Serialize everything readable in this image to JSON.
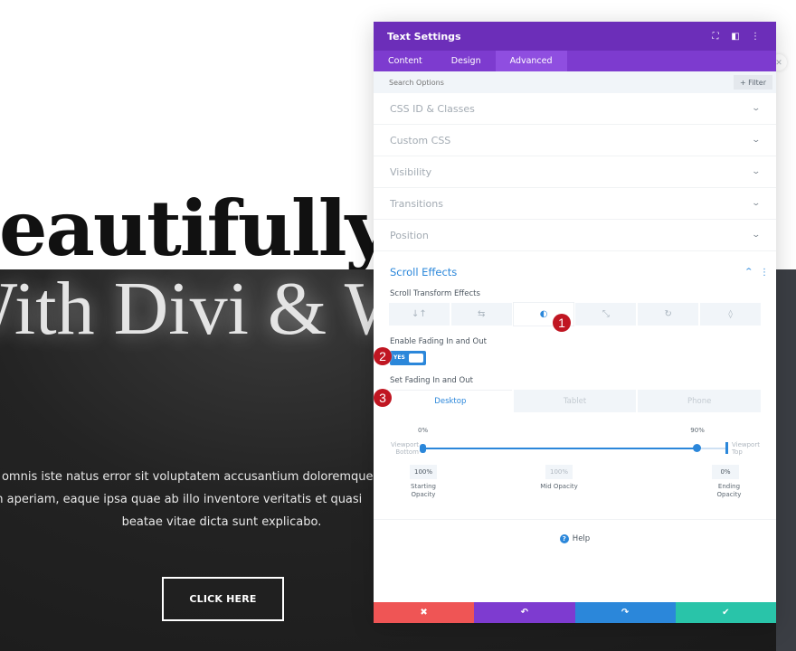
{
  "page": {
    "hero_line1": "Beautifully Crafted",
    "hero_line2": "With Divi & WordPress",
    "body_lines": [
      "Sed ut perspiciatis unde omnis iste natus error sit voluptatem accusantium doloremque",
      "laudantium, totam rem aperiam, eaque ipsa quae ab illo inventore veritatis et quasi",
      "beatae vitae dicta sunt explicabo."
    ],
    "cta_label": "CLICK HERE"
  },
  "modal": {
    "title": "Text Settings",
    "header_icons": [
      "fullscreen-icon",
      "split-view-icon",
      "more-options-icon"
    ],
    "tabs": [
      {
        "label": "Content",
        "active": false
      },
      {
        "label": "Design",
        "active": false
      },
      {
        "label": "Advanced",
        "active": true
      }
    ],
    "search": {
      "placeholder": "Search Options",
      "value": ""
    },
    "filter_label": "+ Filter",
    "sections": [
      {
        "label": "CSS ID & Classes"
      },
      {
        "label": "Custom CSS"
      },
      {
        "label": "Visibility"
      },
      {
        "label": "Transitions"
      },
      {
        "label": "Position"
      }
    ],
    "scroll_effects": {
      "title": "Scroll Effects",
      "transform_label": "Scroll Transform Effects",
      "effects": [
        {
          "icon": "vertical-motion-icon",
          "glyph": "↓↑",
          "active": false
        },
        {
          "icon": "horizontal-motion-icon",
          "glyph": "⇆",
          "active": false
        },
        {
          "icon": "fading-icon",
          "glyph": "◐",
          "active": true
        },
        {
          "icon": "scaling-icon",
          "glyph": "⤡",
          "active": false
        },
        {
          "icon": "rotating-icon",
          "glyph": "↻",
          "active": false
        },
        {
          "icon": "blur-icon",
          "glyph": "💧",
          "active": false
        }
      ],
      "enable_label": "Enable Fading In and Out",
      "toggle_value": "YES",
      "set_label": "Set Fading In and Out",
      "devices": [
        {
          "label": "Desktop",
          "active": true
        },
        {
          "label": "Tablet",
          "active": false
        },
        {
          "label": "Phone",
          "active": false
        }
      ],
      "slider": {
        "start_label": "0%",
        "end_label": "90%",
        "start_value": 0,
        "end_value": 90,
        "viewport_bottom": "Viewport Bottom",
        "viewport_top": "Viewport Top"
      },
      "opacity": {
        "starting": {
          "value": "100%",
          "caption": "Starting Opacity"
        },
        "mid": {
          "value": "100%",
          "caption": "Mid Opacity"
        },
        "ending": {
          "value": "0%",
          "caption": "Ending Opacity"
        }
      }
    },
    "help_label": "Help",
    "footer": [
      {
        "name": "discard",
        "glyph": "✖",
        "color": "#ef5555"
      },
      {
        "name": "undo",
        "glyph": "↶",
        "color": "#7e3bd0"
      },
      {
        "name": "redo",
        "glyph": "↷",
        "color": "#2b87da"
      },
      {
        "name": "save",
        "glyph": "✔",
        "color": "#29c4a9"
      }
    ]
  },
  "annotations": [
    "1",
    "2",
    "3"
  ],
  "colors": {
    "header_purple": "#6c2eb9",
    "tab_purple": "#7d3bcf",
    "accent_blue": "#2b87da",
    "badge_red": "#c01622"
  }
}
